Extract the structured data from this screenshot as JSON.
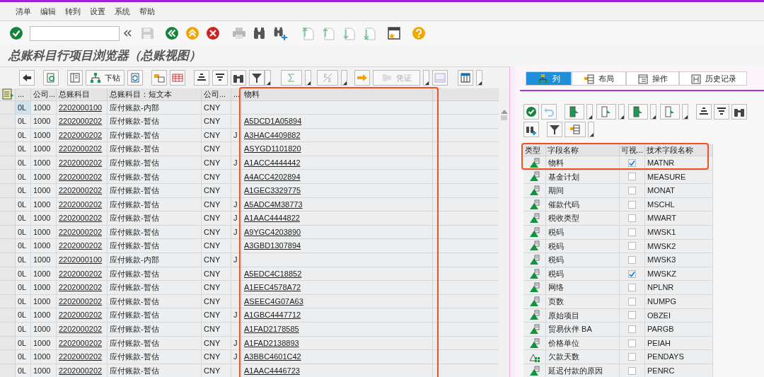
{
  "menu": [
    "清单",
    "编辑",
    "转到",
    "设置",
    "系统",
    "帮助"
  ],
  "title": "总账科目行项目浏览器（总账视图）",
  "alv_toolbar": [
    {
      "label": "下钻",
      "disabled": false
    },
    {
      "label": "凭证",
      "disabled": true
    }
  ],
  "table": {
    "columns": [
      "...",
      "公司...",
      "总账科目",
      "总账科目：短文本",
      "公司...",
      "...",
      "物料"
    ],
    "rows": [
      {
        "selected": true,
        "column_1": "0L",
        "company_code": "1000",
        "gl_account": "2202000100",
        "short_text": "应付账款-内部",
        "currency": "CNY"
      },
      {
        "selected": false,
        "column_1": "0L",
        "company_code": "1000",
        "gl_account": "2202000202",
        "short_text": "应付账款-暂估",
        "currency": "CNY",
        "material": "A5DCD1A05894"
      },
      {
        "selected": false,
        "column_1": "0L",
        "company_code": "1000",
        "gl_account": "2202000202",
        "short_text": "应付账款-暂估",
        "currency": "CNY",
        "column_6": "J",
        "material": "A3HAC4409882"
      },
      {
        "selected": false,
        "column_1": "0L",
        "company_code": "1000",
        "gl_account": "2202000202",
        "short_text": "应付账款-暂估",
        "currency": "CNY",
        "material": "ASYGD1101820"
      },
      {
        "selected": false,
        "column_1": "0L",
        "company_code": "1000",
        "gl_account": "2202000202",
        "short_text": "应付账款-暂估",
        "currency": "CNY",
        "column_6": "J",
        "material": "A1ACC4444442"
      },
      {
        "selected": false,
        "column_1": "0L",
        "company_code": "1000",
        "gl_account": "2202000202",
        "short_text": "应付账款-暂估",
        "currency": "CNY",
        "material": "A4ACC4202894"
      },
      {
        "selected": false,
        "column_1": "0L",
        "company_code": "1000",
        "gl_account": "2202000202",
        "short_text": "应付账款-暂估",
        "currency": "CNY",
        "material": "A1GEC3329775"
      },
      {
        "selected": false,
        "column_1": "0L",
        "company_code": "1000",
        "gl_account": "2202000202",
        "short_text": "应付账款-暂估",
        "currency": "CNY",
        "column_6": "J",
        "material": "A5ADC4M38773"
      },
      {
        "selected": false,
        "column_1": "0L",
        "company_code": "1000",
        "gl_account": "2202000202",
        "short_text": "应付账款-暂估",
        "currency": "CNY",
        "column_6": "J",
        "material": "A1AAC4444822"
      },
      {
        "selected": false,
        "column_1": "0L",
        "company_code": "1000",
        "gl_account": "2202000202",
        "short_text": "应付账款-暂估",
        "currency": "CNY",
        "column_6": "J",
        "material": "A9YGC4203890"
      },
      {
        "selected": false,
        "column_1": "0L",
        "company_code": "1000",
        "gl_account": "2202000202",
        "short_text": "应付账款-暂估",
        "currency": "CNY",
        "material": "A3GBD1307894"
      },
      {
        "selected": false,
        "column_1": "0L",
        "company_code": "1000",
        "gl_account": "2202000100",
        "short_text": "应付账款-内部",
        "currency": "CNY",
        "column_6": "J"
      },
      {
        "selected": false,
        "column_1": "0L",
        "company_code": "1000",
        "gl_account": "2202000202",
        "short_text": "应付账款-暂估",
        "currency": "CNY",
        "material": "A5EDC4C18852"
      },
      {
        "selected": false,
        "column_1": "0L",
        "company_code": "1000",
        "gl_account": "2202000202",
        "short_text": "应付账款-暂估",
        "currency": "CNY",
        "material": "A1EEC4578A72"
      },
      {
        "selected": false,
        "column_1": "0L",
        "company_code": "1000",
        "gl_account": "2202000202",
        "short_text": "应付账款-暂估",
        "currency": "CNY",
        "material": "ASEEC4G07A63"
      },
      {
        "selected": false,
        "column_1": "0L",
        "company_code": "1000",
        "gl_account": "2202000202",
        "short_text": "应付账款-暂估",
        "currency": "CNY",
        "column_6": "J",
        "material": "A1GBC4447712"
      },
      {
        "selected": false,
        "column_1": "0L",
        "company_code": "1000",
        "gl_account": "2202000202",
        "short_text": "应付账款-暂估",
        "currency": "CNY",
        "material": "A1FAD2178585"
      },
      {
        "selected": false,
        "column_1": "0L",
        "company_code": "1000",
        "gl_account": "2202000202",
        "short_text": "应付账款-暂估",
        "currency": "CNY",
        "column_6": "J",
        "material": "A1FAD2138893"
      },
      {
        "selected": false,
        "column_1": "0L",
        "company_code": "1000",
        "gl_account": "2202000202",
        "short_text": "应付账款-暂估",
        "currency": "CNY",
        "column_6": "J",
        "material": "A3BBC4601C42"
      },
      {
        "selected": false,
        "column_1": "0L",
        "company_code": "1000",
        "gl_account": "2202000202",
        "short_text": "应付账款-暂估",
        "currency": "CNY",
        "material": "A1AAC4446723"
      }
    ]
  },
  "layout_tabs": [
    {
      "label": "列",
      "selected": true
    },
    {
      "label": "布局",
      "selected": false
    },
    {
      "label": "操作",
      "selected": false
    },
    {
      "label": "历史记录",
      "selected": false
    }
  ],
  "fields": {
    "columns": [
      "类型",
      "字段名称",
      "可视...",
      "技术字段名称"
    ],
    "rows": [
      {
        "kind": "field",
        "name": "物料",
        "visible": true,
        "tech_name": "MATNR"
      },
      {
        "kind": "field",
        "name": "基金计划",
        "visible": false,
        "tech_name": "MEASURE"
      },
      {
        "kind": "field",
        "name": "期间",
        "visible": false,
        "tech_name": "MONAT"
      },
      {
        "kind": "field",
        "name": "催款代码",
        "visible": false,
        "tech_name": "MSCHL"
      },
      {
        "kind": "field",
        "name": "税收类型",
        "visible": false,
        "tech_name": "MWART"
      },
      {
        "kind": "field",
        "name": "税码",
        "visible": false,
        "tech_name": "MWSK1"
      },
      {
        "kind": "field",
        "name": "税码",
        "visible": false,
        "tech_name": "MWSK2"
      },
      {
        "kind": "field",
        "name": "税码",
        "visible": false,
        "tech_name": "MWSK3"
      },
      {
        "kind": "field",
        "name": "税码",
        "visible": true,
        "tech_name": "MWSKZ"
      },
      {
        "kind": "field",
        "name": "网络",
        "visible": false,
        "tech_name": "NPLNR"
      },
      {
        "kind": "field",
        "name": "页数",
        "visible": false,
        "tech_name": "NUMPG"
      },
      {
        "kind": "field",
        "name": "原始项目",
        "visible": false,
        "tech_name": "OBZEI"
      },
      {
        "kind": "field",
        "name": "贸易伙伴 BA",
        "visible": false,
        "tech_name": "PARGB"
      },
      {
        "kind": "field",
        "name": "价格单位",
        "visible": false,
        "tech_name": "PEIAH"
      },
      {
        "kind": "calculated",
        "name": "欠款天数",
        "visible": false,
        "tech_name": "PENDAYS"
      },
      {
        "kind": "field",
        "name": "延迟付款的原因",
        "visible": false,
        "tech_name": "PENRC"
      }
    ]
  }
}
